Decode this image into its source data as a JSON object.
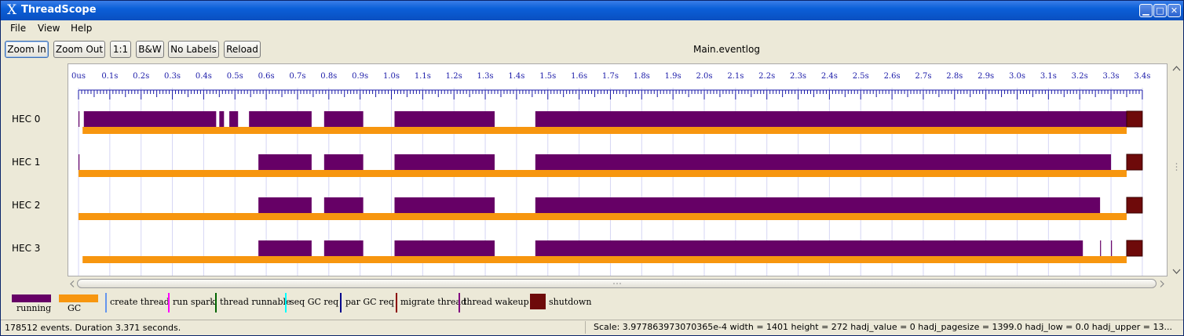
{
  "window": {
    "title": "ThreadScope",
    "logo_glyph": "X",
    "controls": {
      "minimize": "▁",
      "maximize": "□",
      "close": "✕"
    }
  },
  "menu": {
    "items": [
      {
        "label": "File"
      },
      {
        "label": "View"
      },
      {
        "label": "Help"
      }
    ]
  },
  "toolbar": {
    "zoom_in": "Zoom In",
    "zoom_out": "Zoom Out",
    "one_to_one": "1:1",
    "bw": "B&W",
    "no_labels": "No Labels",
    "reload": "Reload"
  },
  "file_name": "Main.eventlog",
  "timeline": {
    "tick_labels": [
      "0us",
      "0.1s",
      "0.2s",
      "0.3s",
      "0.4s",
      "0.5s",
      "0.6s",
      "0.7s",
      "0.8s",
      "0.9s",
      "1.0s",
      "1.1s",
      "1.2s",
      "1.3s",
      "1.4s",
      "1.5s",
      "1.6s",
      "1.7s",
      "1.8s",
      "1.9s",
      "2.0s",
      "2.1s",
      "2.2s",
      "2.3s",
      "2.4s",
      "2.5s",
      "2.6s",
      "2.7s",
      "2.8s",
      "2.9s",
      "3.0s",
      "3.1s",
      "3.2s",
      "3.3s",
      "3.4s"
    ],
    "duration_s": 3.371,
    "hecs": [
      {
        "label": "HEC 0",
        "running": [
          [
            0.0,
            0.003
          ],
          [
            0.017,
            0.44
          ],
          [
            0.45,
            0.465
          ],
          [
            0.482,
            0.51
          ],
          [
            0.545,
            0.745
          ],
          [
            0.785,
            0.91
          ],
          [
            1.01,
            1.33
          ],
          [
            1.46,
            3.35
          ]
        ],
        "gc": [
          [
            0.013,
            3.35
          ]
        ],
        "shutdown": [
          3.35,
          3.4
        ]
      },
      {
        "label": "HEC 1",
        "running": [
          [
            0.0,
            0.003
          ],
          [
            0.575,
            0.745
          ],
          [
            0.785,
            0.91
          ],
          [
            1.01,
            1.33
          ],
          [
            1.46,
            3.3
          ]
        ],
        "gc": [
          [
            0.0,
            3.35
          ]
        ],
        "shutdown": [
          3.35,
          3.4
        ]
      },
      {
        "label": "HEC 2",
        "running": [
          [
            0.575,
            0.745
          ],
          [
            0.785,
            0.91
          ],
          [
            1.01,
            1.33
          ],
          [
            1.46,
            3.265
          ]
        ],
        "gc": [
          [
            0.0,
            3.35
          ]
        ],
        "shutdown": [
          3.35,
          3.4
        ]
      },
      {
        "label": "HEC 3",
        "running": [
          [
            0.575,
            0.745
          ],
          [
            0.785,
            0.91
          ],
          [
            1.01,
            1.33
          ],
          [
            1.46,
            3.21
          ],
          [
            3.265,
            3.268
          ],
          [
            3.3,
            3.303
          ]
        ],
        "gc": [
          [
            0.013,
            3.35
          ]
        ],
        "shutdown": [
          3.35,
          3.4
        ]
      }
    ]
  },
  "legend": {
    "running": "running",
    "gc": "GC",
    "create_thread": "create thread",
    "run_spark": "run spark",
    "thread_runnable": "thread runnable",
    "seq_gc_req": "seq GC req",
    "par_gc_req": "par GC req",
    "migrate_thread": "migrate thread",
    "thread_wakeup": "thread wakeup",
    "shutdown": "shutdown"
  },
  "colors": {
    "running": "#660066",
    "gc": "#f7960f",
    "shutdown": "#6e0a0a",
    "create_thread": "#6495ed",
    "run_spark": "#ff00ff",
    "thread_runnable": "#006400",
    "seq_gc_req": "#00ffff",
    "par_gc_req": "#00008b",
    "migrate_thread": "#8b0000",
    "thread_wakeup": "#800080",
    "tick": "#1a1aa8"
  },
  "status": {
    "events": "178512 events. Duration 3.371 seconds.",
    "scale": "Scale: 3.977863973070365e-4 width = 1401 height = 272 hadj_value = 0 hadj_pagesize = 1399.0 hadj_low = 0.0 hadj_upper = 13..."
  }
}
